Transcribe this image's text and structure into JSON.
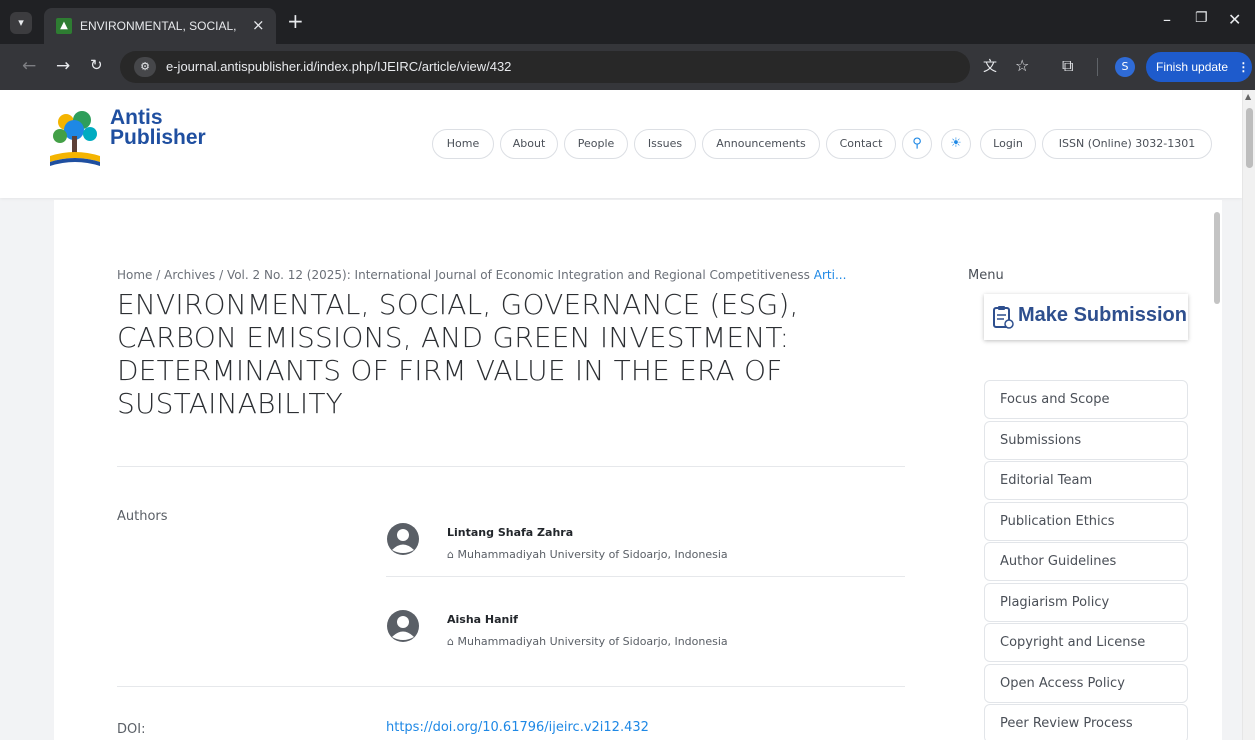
{
  "browser": {
    "tab_title": "ENVIRONMENTAL, SOCIAL, GO",
    "tab_close": "×",
    "new_tab": "+",
    "minimize": "–",
    "restore": "❐",
    "close": "✕",
    "url": "e-journal.antispublisher.id/index.php/IJEIRC/article/view/432",
    "profile_initial": "S",
    "finish_update_label": "Finish update",
    "finish_update_more": "⋮"
  },
  "site": {
    "logo_line1": "Antis",
    "logo_line2": "Publisher",
    "nav": {
      "home": "Home",
      "about": "About",
      "people": "People",
      "issues": "Issues",
      "announcements": "Announcements",
      "contact": "Contact",
      "login": "Login",
      "issn": "ISSN (Online) 3032-1301"
    }
  },
  "breadcrumb": {
    "home": "Home",
    "sep": " / ",
    "archives": "Archives",
    "issue": "Vol. 2 No. 12 (2025): International Journal of Economic Integration and Regional Competitiveness",
    "current": "Arti..."
  },
  "article": {
    "title_lines": [
      "ENVIRONMENTAL, SOCIAL, GOVERNANCE (ESG),",
      "CARBON EMISSIONS, AND GREEN INVESTMENT:",
      "DETERMINANTS OF FIRM VALUE IN THE ERA OF",
      "SUSTAINABILITY"
    ],
    "authors_label": "Authors",
    "authors": [
      {
        "name": "Lintang Shafa Zahra",
        "affiliation": "Muhammadiyah University of Sidoarjo, Indonesia"
      },
      {
        "name": "Aisha Hanif",
        "affiliation": "Muhammadiyah University of Sidoarjo, Indonesia"
      }
    ],
    "doi_label": "DOI:",
    "doi_url": "https://doi.org/10.61796/ijeirc.v2i12.432"
  },
  "sidebar": {
    "menu_label": "Menu",
    "make_submission": "Make Submission",
    "items": [
      "Focus and Scope",
      "Submissions",
      "Editorial Team",
      "Publication Ethics",
      "Author Guidelines",
      "Plagiarism Policy",
      "Copyright and License",
      "Open Access Policy",
      "Peer Review Process"
    ]
  },
  "colors": {
    "accent": "#1e88e5",
    "brand": "#1f4fa0",
    "chrome_dark": "#202124",
    "update_button": "#1e5bcc"
  }
}
